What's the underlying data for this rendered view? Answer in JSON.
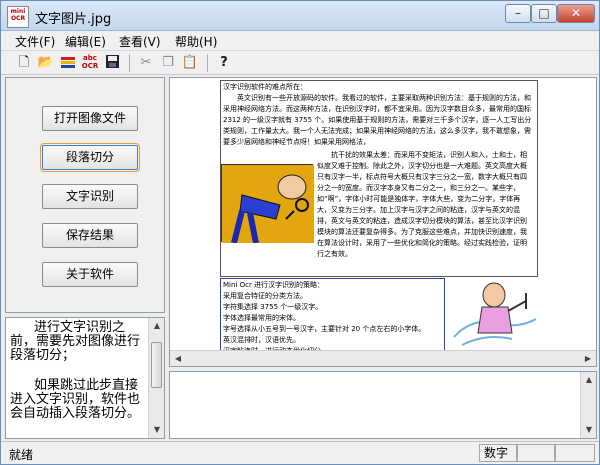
{
  "window": {
    "title": "文字图片.jpg",
    "icon_text": "miniOCR"
  },
  "menu": [
    {
      "label": "文件(F)"
    },
    {
      "label": "编辑(E)"
    },
    {
      "label": "查看(V)"
    },
    {
      "label": "帮助(H)"
    }
  ],
  "toolbar": [
    "new-file-icon",
    "open-folder-icon",
    "scan-icon",
    "ocr-icon",
    "save-icon",
    "cut-icon",
    "copy-icon",
    "paste-icon",
    "help-icon"
  ],
  "left_buttons": [
    {
      "label": "打开图像文件"
    },
    {
      "label": "段落切分"
    },
    {
      "label": "文字识别"
    },
    {
      "label": "保存结果"
    },
    {
      "label": "关于软件"
    }
  ],
  "hint_text": {
    "p1": "进行文字识别之前，需要先对图像进行段落切分；",
    "p2": "如果跳过此步直接进入文字识别，软件也会自动插入段落切分。"
  },
  "document": {
    "b1_title": "汉字识别软件的难点所在：",
    "b1_p1": "英文识别有一些开放源码的软件。我看过的软件，主要采取两种识别方法：基于规则的方法，和采用神经网络方法。而这两种方法，在识别汉字时，都不宜采用。因为汉字数目众多，最常用的国标 2312 的一级汉字就有 3755 个。如果使用基于规则的方法，需要对三千多个汉字，逐一人工写出分类规则，工作量太大。我一个人无法完成；如果采用神经网络的方法，这么多汉字，我不敢想象，需要多少层网络和神经节点呀！如果采用网格法，",
    "b1_p2": "抗干扰的效果太差：而采用不变矩法，识别人和入，土和士，相似度又难于控制。除此之外，汉字切分也是一大难题。英文高度大概只有汉字一半，标点符号大概只有汉字三分之一宽，数字大概只有四分之一的宽度。而汉字本身又有二分之一，和三分之一。某些字，如“啊”，字体小时可能是独体字，字体大些，变为二分字，字体再大，又变为三分字。加上汉字与汉字之间的粘连，汉字与英文的混排，英文与英文的粘连，造成汉字切分模块的算法，甚至比汉字识别模块的算法还要复杂得多。为了克服这些难点，并加快识别速度，我在算法设计时，采用了一些优化和简化的策略。经过实践检验，证明行之有效。",
    "b2_lines": [
      "Mini Ocr 进行汉字识别的策略：",
      "采用复合特征的分类方法。",
      "字符集选择 3755 个一级汉字。",
      "字体选择最常用的宋体。",
      "字号选择从小五号到一号汉字，主要针对 20 个点左右的小字体。",
      "英汉混排时，汉语优先。",
      "汉字粘连时，进行动态优化切分。"
    ]
  },
  "status": {
    "left": "就绪",
    "cell1": "数字",
    "cell2": "",
    "cell3": ""
  }
}
